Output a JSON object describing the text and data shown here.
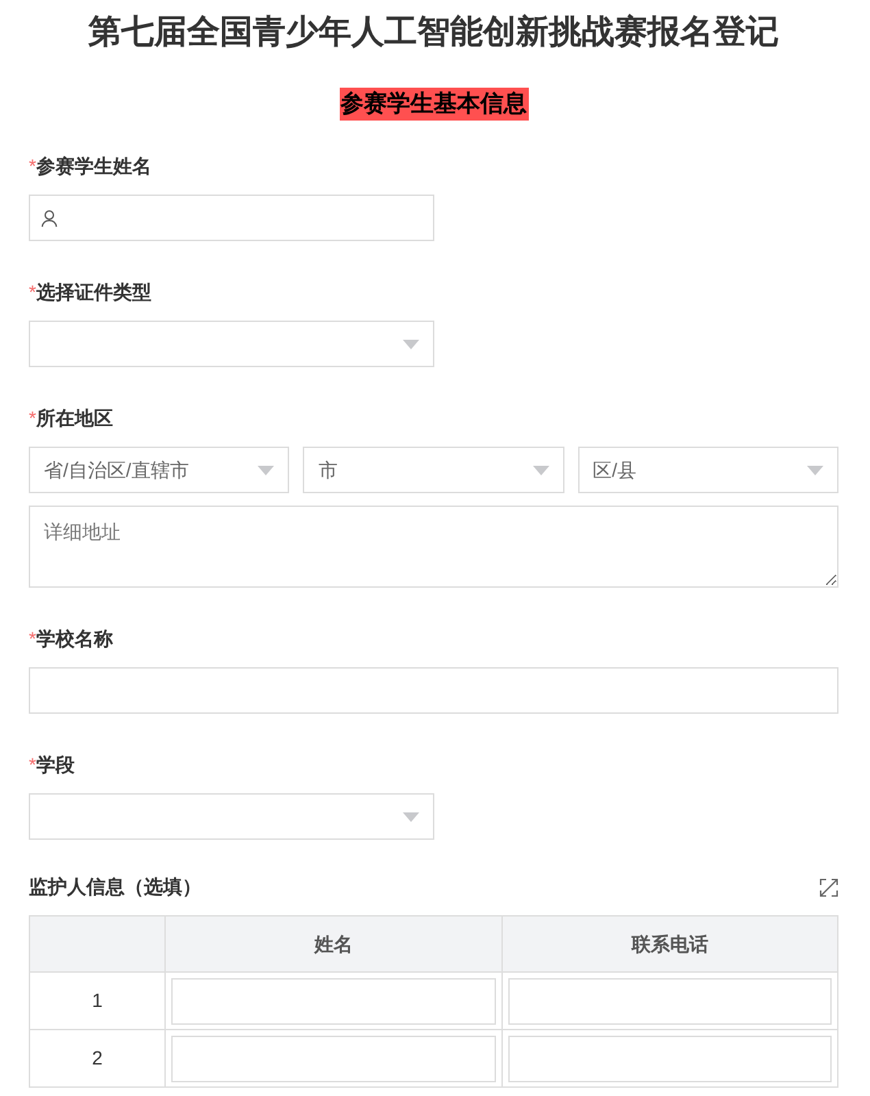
{
  "title": "第七届全国青少年人工智能创新挑战赛报名登记",
  "section_heading": "参赛学生基本信息",
  "required_mark": "*",
  "fields": [
    {
      "kind": "person",
      "label": "参赛学生姓名",
      "required": true
    },
    {
      "kind": "select",
      "label": "选择证件类型",
      "required": true
    },
    {
      "kind": "region",
      "label": "所在地区",
      "required": true,
      "selects": [
        {
          "placeholder": "省/自治区/直辖市"
        },
        {
          "placeholder": "市"
        },
        {
          "placeholder": "区/县"
        }
      ],
      "address": {
        "placeholder": "详细地址"
      }
    },
    {
      "kind": "text",
      "label": "学校名称",
      "required": true
    },
    {
      "kind": "select",
      "label": "学段",
      "required": true
    }
  ],
  "guardian": {
    "label": "监护人信息（选填）",
    "columns": [
      "姓名",
      "联系电话"
    ],
    "rows": [
      {
        "index": "1"
      },
      {
        "index": "2"
      }
    ]
  }
}
